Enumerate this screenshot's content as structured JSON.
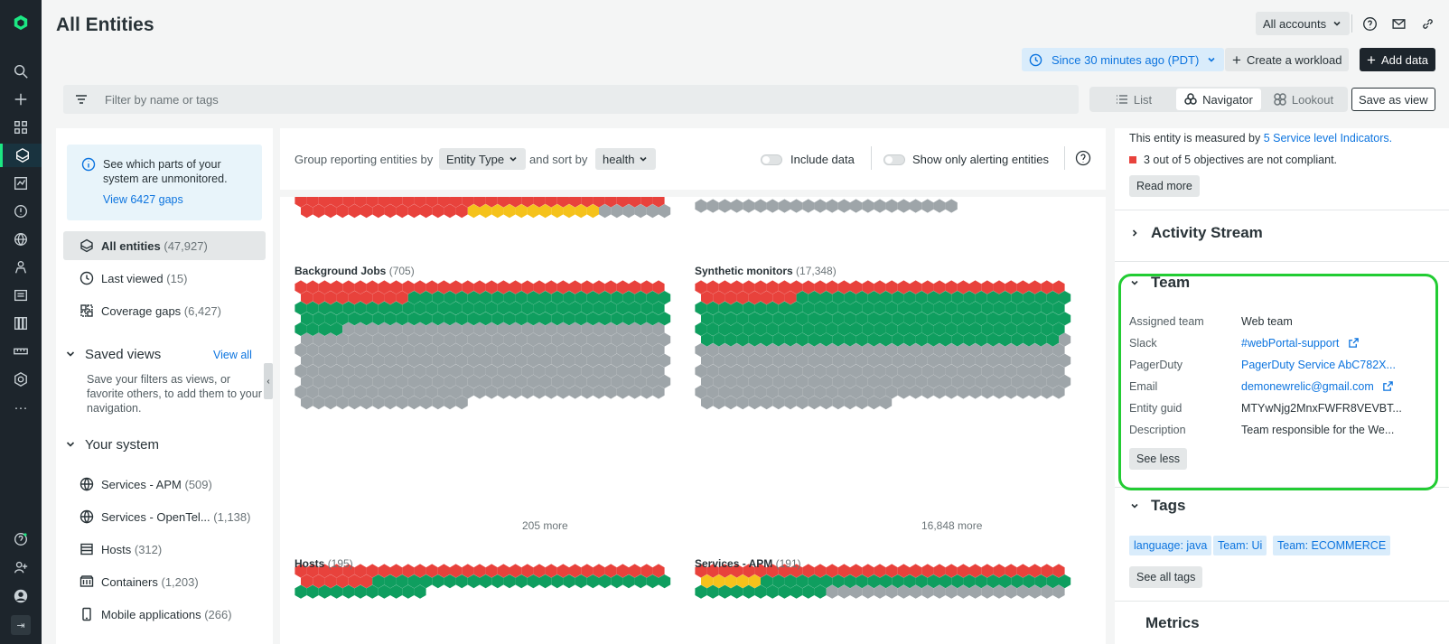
{
  "header": {
    "title": "All Entities",
    "accounts_label": "All accounts",
    "time_label": "Since 30 minutes ago (PDT)",
    "create_workload_label": "Create a workload",
    "add_data_label": "Add data"
  },
  "filter": {
    "placeholder": "Filter by name or tags"
  },
  "view_toggle": {
    "list": "List",
    "navigator": "Navigator",
    "lookout": "Lookout",
    "selected": "Navigator"
  },
  "save_view_label": "Save as view",
  "left_panel": {
    "gap_card": {
      "text": "See which parts of your system are unmonitored.",
      "link": "View 6427 gaps"
    },
    "items": [
      {
        "label": "All entities",
        "count": "(47,927)"
      },
      {
        "label": "Last viewed",
        "count": "(15)"
      },
      {
        "label": "Coverage gaps",
        "count": "(6,427)"
      }
    ],
    "saved_views": {
      "title": "Saved views",
      "view_all": "View all",
      "hint": "Save your filters as views, or favorite others, to add them to your navigation."
    },
    "your_system": {
      "title": "Your system",
      "items": [
        {
          "label": "Services - APM",
          "count": "(509)"
        },
        {
          "label": "Services - OpenTel...",
          "count": "(1,138)"
        },
        {
          "label": "Hosts",
          "count": "(312)"
        },
        {
          "label": "Containers",
          "count": "(1,203)"
        },
        {
          "label": "Mobile applications",
          "count": "(266)"
        }
      ]
    }
  },
  "group_bar": {
    "group_label": "Group reporting entities by",
    "group_value": "Entity Type",
    "sort_label": "and sort by",
    "sort_value": "health",
    "include_data": "Include data",
    "only_alerting": "Show only alerting entities"
  },
  "groups": [
    {
      "title": "Background Jobs",
      "count": "(705)",
      "more": "205 more"
    },
    {
      "title": "Synthetic monitors",
      "count": "(17,348)",
      "more": "16,848 more"
    },
    {
      "title": "Hosts",
      "count": "(195)"
    },
    {
      "title": "Services - APM",
      "count": "(191)"
    }
  ],
  "right_panel": {
    "sli_prefix": "This entity is measured by",
    "sli_link": "5 Service level Indicators.",
    "objectives": "3 out of 5 objectives are not compliant.",
    "read_more": "Read more",
    "activity_stream": "Activity Stream",
    "team": {
      "title": "Team",
      "rows": [
        {
          "label": "Assigned team",
          "value": "Web team"
        },
        {
          "label": "Slack",
          "value": "#webPortal-support"
        },
        {
          "label": "PagerDuty",
          "value": "PagerDuty Service AbC782X..."
        },
        {
          "label": "Email",
          "value": "demonewrelic@gmail.com"
        },
        {
          "label": "Entity guid",
          "value": "MTYwNjg2MnxFWFR8VEVBT..."
        },
        {
          "label": "Description",
          "value": "Team responsible for the We..."
        }
      ],
      "see_less": "See less"
    },
    "tags": {
      "title": "Tags",
      "items": [
        "language: java",
        "Team: Ui",
        "Team: ECOMMERCE"
      ],
      "see_all": "See all tags"
    },
    "metrics": "Metrics"
  },
  "colors": {
    "critical": "#e8423c",
    "healthy": "#0f9e5f",
    "warning": "#f5c21b",
    "no_data": "#9ea5a9",
    "accent": "#1ce783",
    "link": "#0c74df"
  },
  "hex_maps": {
    "top_left": {
      "critical": 45,
      "warning": 11,
      "no_data": 6
    },
    "top_right": {
      "no_data": 22
    },
    "background_jobs": {
      "critical": 40,
      "healthy": 88,
      "no_data": 227
    },
    "synthetic_monitors": {
      "critical": 39,
      "healthy": 146,
      "no_data": 172
    },
    "hosts": {
      "critical": 37,
      "healthy": 36
    },
    "services_apm": {
      "critical": 31,
      "warning": 5,
      "healthy": 37,
      "no_data": 20
    }
  }
}
